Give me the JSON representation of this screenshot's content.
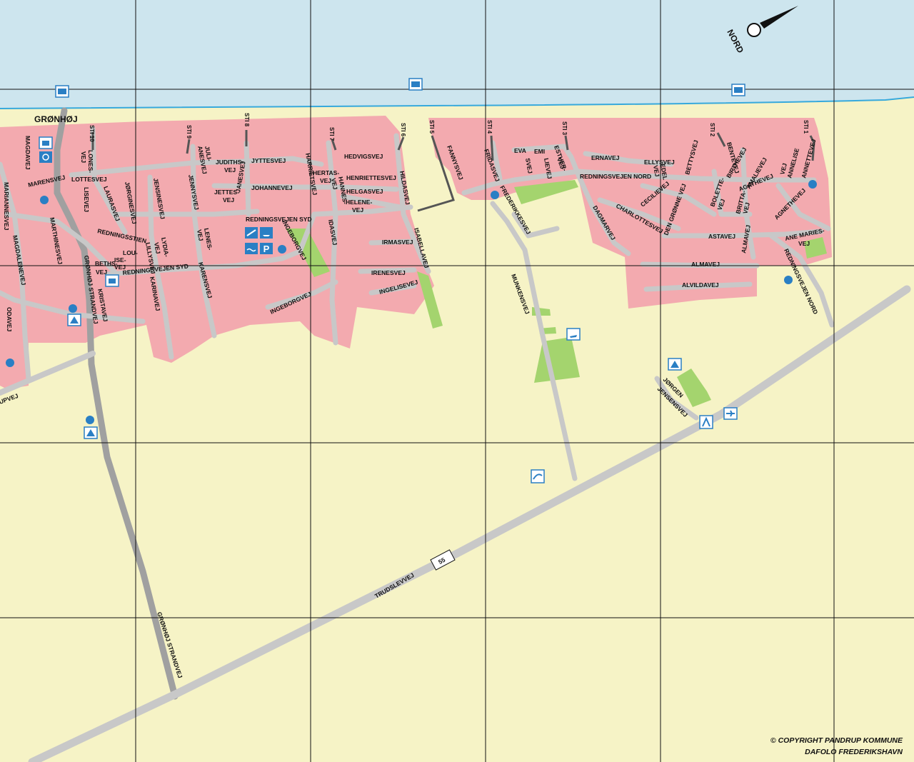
{
  "town_label": "GRØNHØJ",
  "compass_label": "NORD",
  "route_number": "55",
  "copyright": {
    "line1": "© COPYRIGHT PANDRUP KOMMUNE",
    "line2": "DAFOLO FREDERIKSHAVN"
  },
  "beach_paths": [
    "STI 10",
    "STI 9",
    "STI 8",
    "STI 7",
    "STI 6",
    "STI 5",
    "STI 4",
    "STI 3",
    "STI 2",
    "STI 1"
  ],
  "roads": {
    "magdavej": "MAGDAVEJ",
    "marensvej": "MARENSVEJ",
    "mariannesvej": "MARIANNESVEJ",
    "magdalenevej": "MAGDALENEVEJ",
    "odavej": "ODAVEJ",
    "upvej": "UPVEJ",
    "lonesvej_1": "LONES-",
    "lonesvej_2": "VEJ",
    "lottesvej": "LOTTESVEJ",
    "lisevej": "LISEVEJ",
    "laurasvej": "LAURASVEJ",
    "marthinesvej": "MARTHINESVEJ",
    "jorginesvej": "JØRGINESVEJ",
    "jensinesvej": "JENSINESVEJ",
    "jennysvej": "JENNYSVEJ",
    "julianesvej_1": "JULI-",
    "julianesvej_2": "ANESVEJ",
    "judithsvej_1": "JUDITHS-",
    "judithsvej_2": "VEJ",
    "jyttesvej": "JYTTESVEJ",
    "jettesvej_1": "JETTES-",
    "jettesvej_2": "VEJ",
    "janesvej": "JANESVEJ",
    "johannevej": "JOHANNEVEJ",
    "redningsvejen_syd": "REDNINGSVEJEN SYD",
    "redningsstien": "REDNINGSSTIEN",
    "lillysvej": "LILLYSVEJ",
    "lydiavej_1": "LYDIA-",
    "lydiavej_2": "VEJ",
    "lenesvej_1": "LENES-",
    "lenesvej_2": "VEJ",
    "louisevej_1": "LOU-",
    "louisevej_2": "ISE-",
    "louisevej_3": "VEJ",
    "bethsvej_1": "BETHS-",
    "bethsvej_2": "VEJ",
    "karinavej": "KARINAVEJ",
    "karensvej": "KARENSVEJ",
    "kristavej": "KRISTAVEJ",
    "gronhoj_strandvej": "GRØNHØJ STRANDVEJ",
    "ingeborgvej": "INGEBORGVEJ",
    "hertasvej_1": "HERTAS-",
    "hertasvej_2": "VEJ",
    "hedvigsvej": "HEDVIGSVEJ",
    "harrietsvej": "HARRIETSVEJ",
    "henriettesvej": "HENRIETTESVEJ",
    "hannesvej_1": "HANNES-",
    "hannesvej_2": "VEJ",
    "helgasvej": "HELGASVEJ",
    "helenevej_1": "HELENE-",
    "helenevej_2": "VEJ",
    "idasvej": "IDASVEJ",
    "irmasvej": "IRMASVEJ",
    "irenesvej": "IRENESVEJ",
    "ingelisevej": "INGELISEVEJ",
    "isabellavej": "ISABELLAVEJ",
    "hildasvej": "HILDASVEJ",
    "fannysvej": "FANNYSVEJ",
    "fridasvej": "FRIDASVEJ",
    "frederikkesvej": "FREDERIKKESVEJ",
    "evasvej_1": "EVA",
    "evasvej_2": "SVEJ",
    "emiliesvej_1": "EMI",
    "emiliesvej_2": "LIEVEJ",
    "esthervej_1": "ESTHER-",
    "esthervej_2": "VEJ",
    "ernavej": "ERNAVEJ",
    "ellysvej": "ELLYSVEJ",
    "redningsvejen_nord": "REDNINGSVEJEN NORD",
    "dagmarvej": "DAGMARVEJ",
    "charlottesvej": "CHARLOTTESVEJ",
    "cecilievej": "CECILIEVEJ",
    "edelvej_1": "EDEL",
    "edelvej_2": "VEJ",
    "den_gronne_vej": "DEN GRØNNE VEJ",
    "bettysvej": "BETTYSVEJ",
    "bentevej": "BENTEVEJ",
    "birthevej": "BIRTHEVEJ",
    "bolettevej_1": "BOLETTE-",
    "bolettevej_2": "VEJ",
    "brittavej_1": "BRITTA-",
    "brittavej_2": "VEJ",
    "amalievej": "AMALIEVEJ",
    "agathevej": "AGATHEVEJ",
    "annelisevej_1": "ANNELISE",
    "annelisevej_2": "VEJ",
    "annettevej": "ANNETTEVEJ",
    "agnethevej": "AGNETHEVEJ",
    "ane_mariesvej_1": "ANE MARIES-",
    "ane_mariesvej_2": "VEJ",
    "astavej": "ASTAVEJ",
    "almavej": "ALMAVEJ",
    "alvildavej": "ALVILDAVEJ",
    "munkensvej": "MUNKENSVEJ",
    "jorgen_jensensvej_1": "JØRGEN",
    "jorgen_jensensvej_2": "JENSENSVEJ",
    "trudslevvej": "TRUDSLEVVEJ"
  },
  "symbols": [
    "lifeguard-icon",
    "telephone-icon",
    "attraction-icon",
    "bus-stop-icon",
    "camping-icon",
    "parking-icon",
    "swimming-icon",
    "surfing-icon",
    "playground-icon",
    "airport-icon",
    "golf-icon",
    "boat-icon"
  ],
  "colors": {
    "land": "#f6f3c6",
    "sea": "#cde5ee",
    "town": "#f3aaaf",
    "road": "#c8c8c8",
    "main_road": "#a0a0a0",
    "park": "#a4d46e",
    "symbol": "#2a7fc4",
    "grid": "#111111"
  }
}
